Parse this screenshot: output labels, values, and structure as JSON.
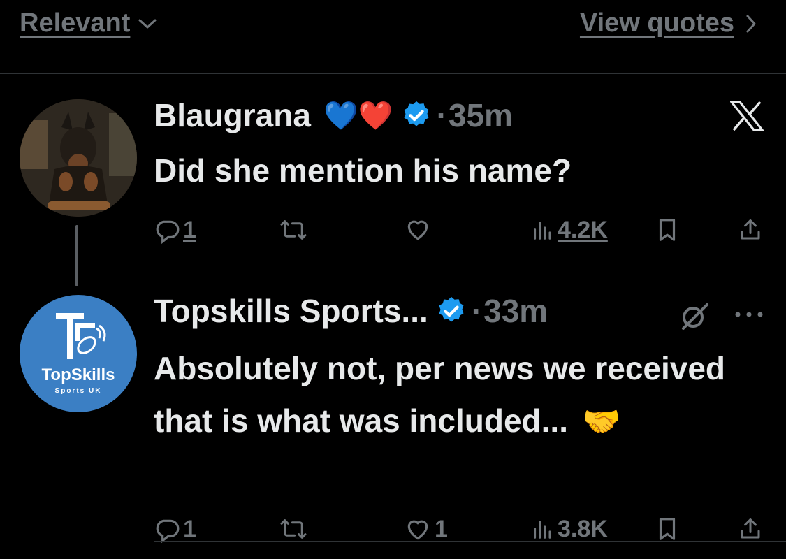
{
  "header": {
    "sort_label": "Relevant",
    "quotes_label": "View quotes"
  },
  "tweets": [
    {
      "author": "Blaugrana",
      "author_emojis": "💙❤️",
      "separator": "·",
      "time": "35m",
      "text": "Did she mention his name?",
      "replies": "1",
      "reposts": "",
      "likes": "",
      "views": "4.2K"
    },
    {
      "author": "Topskills Sports...",
      "separator": "·",
      "time": "33m",
      "text": "Absolutely not, per news we received that is what was included...",
      "emoji": "🤝",
      "replies": "1",
      "reposts": "",
      "likes": "1",
      "views": "3.8K",
      "avatar_logo_text": "TopSkills",
      "avatar_logo_subtext": "Sports UK"
    }
  ],
  "colors": {
    "background": "#000000",
    "text": "#e7e9ea",
    "muted": "#71767b",
    "verified": "#1d9bf0",
    "avatar_blue": "#3b7fc4"
  }
}
